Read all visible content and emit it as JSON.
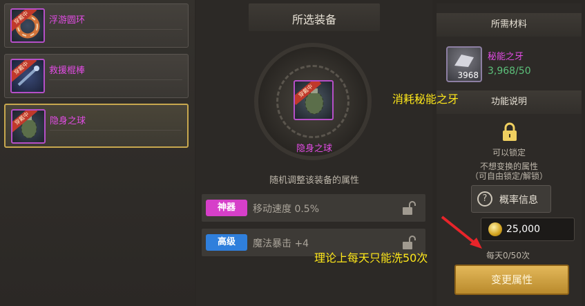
{
  "equipment_list": {
    "items": [
      {
        "name": "浮游圆环",
        "tag": "穿戴中",
        "selected": false
      },
      {
        "name": "救援棍棒",
        "tag": "穿戴中",
        "selected": false
      },
      {
        "name": "隐身之球",
        "tag": "穿戴中",
        "selected": true
      }
    ]
  },
  "center": {
    "title": "所选装备",
    "selected_item_name": "隐身之球",
    "selected_item_tag": "穿戴中",
    "description": "随机调整该装备的属性",
    "attributes": [
      {
        "badge": "神器",
        "badge_color": "#d63fc9",
        "text": "移动速度 0.5%"
      },
      {
        "badge": "高级",
        "badge_color": "#2f7fdc",
        "text": "魔法暴击 +4"
      }
    ]
  },
  "right": {
    "materials_title": "所需材料",
    "material": {
      "name": "秘能之牙",
      "count": "3968",
      "progress": "3,968/50"
    },
    "function_title": "功能说明",
    "lock_text": "可以锁定",
    "lock_note_1": "不想变换的属性",
    "lock_note_2": "（可自由锁定/解锁）",
    "prob_button": "概率信息",
    "cost": "25,000",
    "daily": "每天0/50次",
    "change_button": "变更属性"
  },
  "annotations": {
    "consume": "消耗秘能之牙",
    "daily_limit": "理论上每天只能洗50次"
  }
}
